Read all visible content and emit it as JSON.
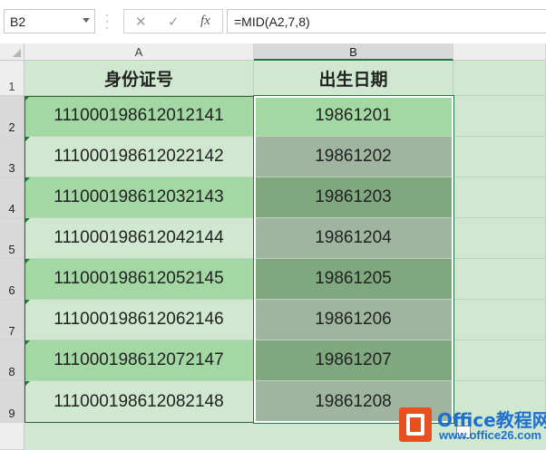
{
  "formula_bar": {
    "name_box": "B2",
    "cancel_symbol": "✕",
    "enter_symbol": "✓",
    "fx_symbol": "fx",
    "formula": "=MID(A2,7,8)"
  },
  "columns": [
    "A",
    "B"
  ],
  "rows": [
    "1",
    "2",
    "3",
    "4",
    "5",
    "6",
    "7",
    "8",
    "9"
  ],
  "table": {
    "header": [
      "身份证号",
      "出生日期"
    ],
    "data": [
      [
        "111000198612012141",
        "19861201"
      ],
      [
        "111000198612022142",
        "19861202"
      ],
      [
        "111000198612032143",
        "19861203"
      ],
      [
        "111000198612042144",
        "19861204"
      ],
      [
        "111000198612052145",
        "19861205"
      ],
      [
        "111000198612062146",
        "19861206"
      ],
      [
        "111000198612072147",
        "19861207"
      ],
      [
        "111000198612082148",
        "19861208"
      ]
    ]
  },
  "colors": {
    "sheet_bg": "#cfe8cf",
    "col_a_dark": "#a3d7a3",
    "col_a_light": "#cfe8cf",
    "col_b_first": "#a3d7a3",
    "col_b_dark": "#7fa87f",
    "col_b_light": "#9fb59f",
    "selection_accent": "#217346"
  },
  "watermark": {
    "title": "Office教程网",
    "url": "www.office26.com"
  }
}
